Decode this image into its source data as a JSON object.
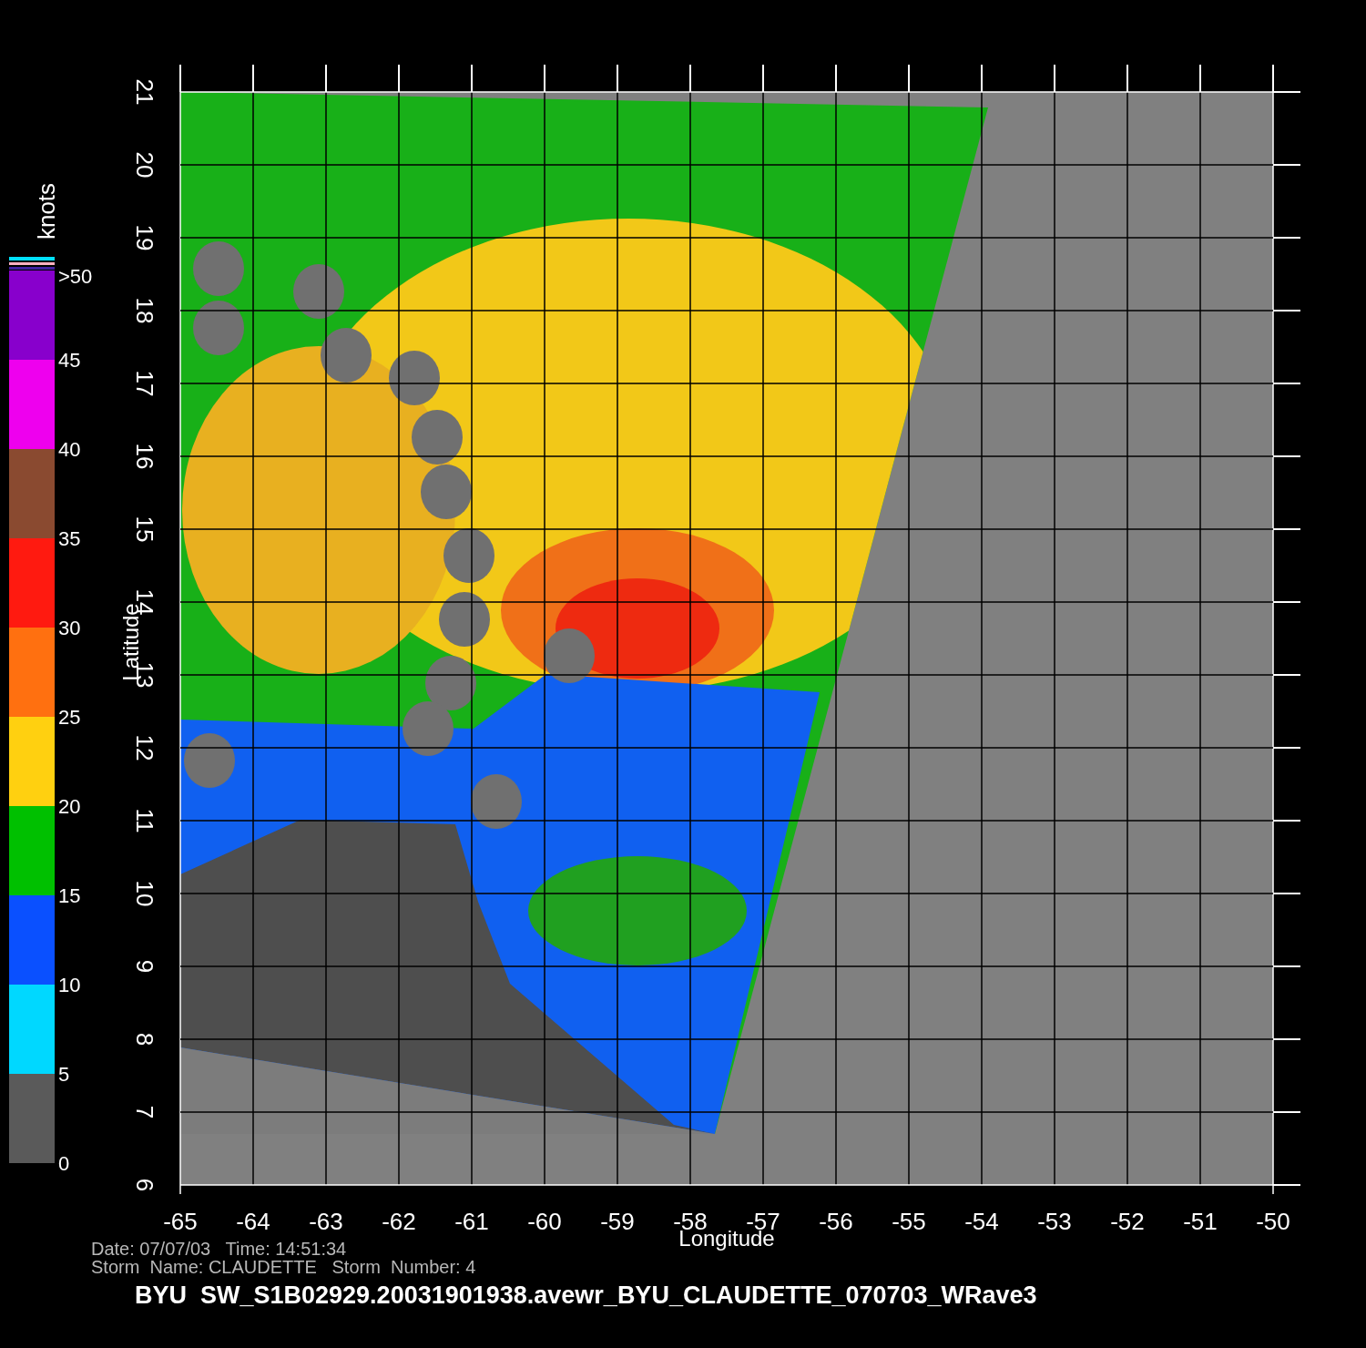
{
  "plot": {
    "xlabel": "Longitude",
    "ylabel": "Latitude",
    "xticks": [
      "-65",
      "-64",
      "-63",
      "-62",
      "-61",
      "-60",
      "-59",
      "-58",
      "-57",
      "-56",
      "-55",
      "-54",
      "-53",
      "-52",
      "-51",
      "-50"
    ],
    "yticks": [
      "21",
      "20",
      "19",
      "18",
      "17",
      "16",
      "15",
      "14",
      "13",
      "12",
      "11",
      "10",
      "9",
      "8",
      "7",
      "6"
    ]
  },
  "legend": {
    "title": "knots",
    "top_label": ">50",
    "bins": [
      {
        "label": "45",
        "color": "#8800cc"
      },
      {
        "label": "40",
        "color": "#ee00ee"
      },
      {
        "label": "35",
        "color": "#8a4a30"
      },
      {
        "label": "30",
        "color": "#ff1a10"
      },
      {
        "label": "25",
        "color": "#ff7010"
      },
      {
        "label": "20",
        "color": "#ffd010"
      },
      {
        "label": "15",
        "color": "#00c000"
      },
      {
        "label": "10",
        "color": "#0a50ff"
      },
      {
        "label": "5",
        "color": "#00d8ff"
      },
      {
        "label": "0",
        "color": "#5a5a5a"
      }
    ]
  },
  "footer": {
    "date_line": "Date: 07/07/03   Time: 14:51:34",
    "storm_line": "Storm  Name: CLAUDETTE   Storm  Number: 4",
    "caption": "BYU  SW_S1B02929.20031901938.avewr_BYU_CLAUDETTE_070703_WRave3"
  }
}
